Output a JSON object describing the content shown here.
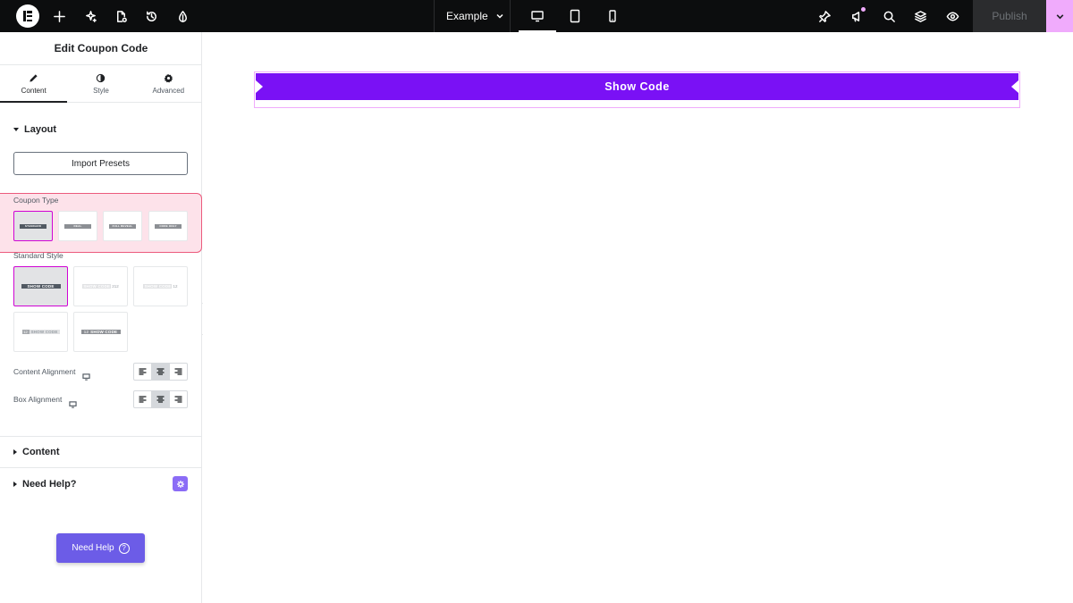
{
  "topbar": {
    "page_name": "Example",
    "publish_label": "Publish",
    "left_icons": [
      "elementor-logo-icon",
      "add-icon",
      "sparkle-ai-icon",
      "page-settings-icon",
      "history-icon",
      "site-settings-icon"
    ],
    "right_icons": [
      "pin-icon",
      "announcements-icon",
      "search-icon",
      "structure-layers-icon",
      "preview-eye-icon"
    ],
    "devices": [
      "desktop-icon",
      "tablet-icon",
      "mobile-icon"
    ],
    "active_device": "desktop"
  },
  "panel": {
    "title": "Edit Coupon Code",
    "tabs": [
      {
        "label": "Content",
        "icon": "pencil-icon",
        "active": true
      },
      {
        "label": "Style",
        "icon": "contrast-icon",
        "active": false
      },
      {
        "label": "Advanced",
        "icon": "gear-icon",
        "active": false
      }
    ],
    "layout_section": "Layout",
    "import_presets": "Import Presets",
    "coupon_type_label": "Coupon Type",
    "coupon_type_options": [
      "STANDARD",
      "DEAL",
      "FULL REVEAL",
      "CODE ONLY"
    ],
    "coupon_type_selected": 0,
    "standard_style_label": "Standard Style",
    "standard_style_options": [
      {
        "text": "SHOW CODE",
        "code": ""
      },
      {
        "text": "SHOW CODE",
        "code": "212"
      },
      {
        "text": "SHOW CODE",
        "code": "12"
      },
      {
        "text": "SHOW CODE",
        "code": "12"
      },
      {
        "text": "SHOW CODE",
        "code": "12"
      }
    ],
    "standard_style_selected": 0,
    "content_alignment_label": "Content Alignment",
    "box_alignment_label": "Box Alignment",
    "alignment_options": [
      "align-left-icon",
      "align-center-icon",
      "align-right-icon"
    ],
    "content_alignment_selected": "center",
    "box_alignment_selected": "center",
    "content_section": "Content",
    "need_help_section": "Need Help?",
    "need_help_button": "Need Help",
    "need_help_q": "?"
  },
  "canvas": {
    "coupon_button_label": "Show Code",
    "accent_color": "#7a11f5",
    "outline_color": "#f0abfc"
  },
  "colors": {
    "topbar_bg": "#0c0d0e",
    "highlight_bg": "#fde2ea",
    "highlight_border": "#ec5b7d",
    "help_button": "#6c5ce7"
  }
}
